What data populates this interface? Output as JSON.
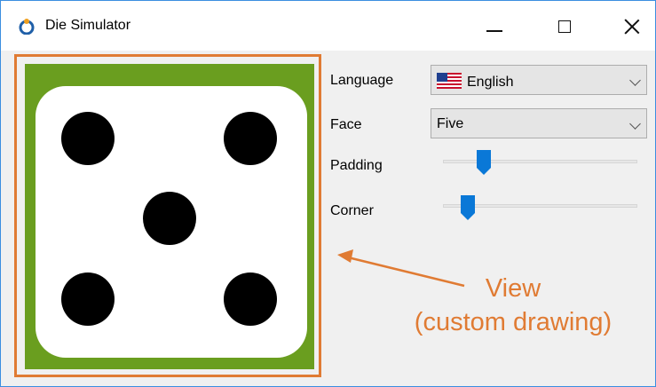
{
  "window": {
    "title": "Die Simulator",
    "icon": "die-app-icon",
    "controls": {
      "minimize": "minimize-icon",
      "maximize": "maximize-icon",
      "close": "close-icon"
    }
  },
  "view": {
    "background_color": "#6a9e1f",
    "face_color": "#ffffff",
    "pip_color": "#000000",
    "outline_color": "#e07b33",
    "pips_shown": 5
  },
  "controls": {
    "language": {
      "label": "Language",
      "value": "English",
      "flag": "us-flag-icon"
    },
    "face": {
      "label": "Face",
      "value": "Five"
    },
    "padding": {
      "label": "Padding",
      "value_fraction": 0.21
    },
    "corner": {
      "label": "Corner",
      "value_fraction": 0.13
    }
  },
  "annotation": {
    "line1": "View",
    "line2": "(custom drawing)",
    "color": "#e07b33"
  }
}
